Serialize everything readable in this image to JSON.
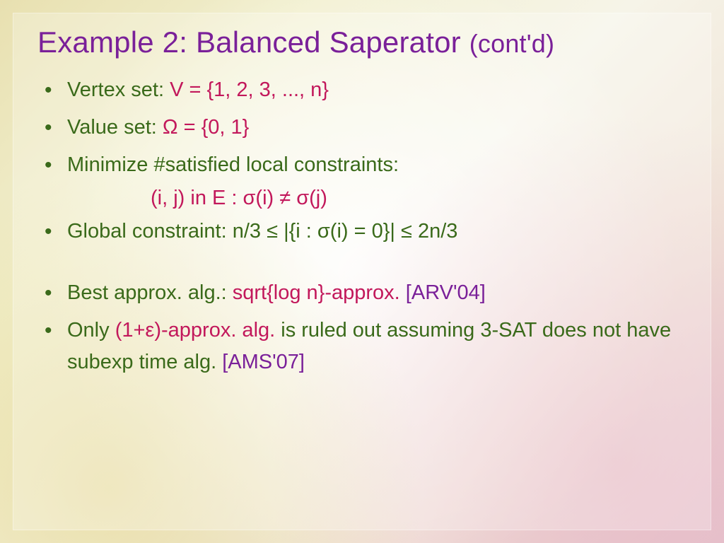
{
  "title": {
    "main": "Example 2: Balanced Saperator ",
    "sub": "(cont'd)"
  },
  "bullets": {
    "b1": {
      "label": "Vertex set: ",
      "value": "V = {1, 2, 3, ..., n}"
    },
    "b2": {
      "label": "Value set: ",
      "value": "Ω = {0, 1}"
    },
    "b3": {
      "label": "Minimize #satisfied local constraints:"
    },
    "b3_sub": "(i, j) in E :  σ(i) ≠ σ(j)",
    "b4": {
      "label": "Global constraint: n/3 ≤ |{i : σ(i) = 0}| ≤ 2n/3"
    },
    "b5": {
      "label": "Best approx. alg.: ",
      "value": "sqrt{log n}-approx. ",
      "cite": "[ARV'04]"
    },
    "b6": {
      "pre": "Only ",
      "value": "(1+ε)-approx. alg. ",
      "post": "is ruled out assuming 3-SAT does not have subexp time alg.  ",
      "cite": "[AMS'07]"
    }
  }
}
